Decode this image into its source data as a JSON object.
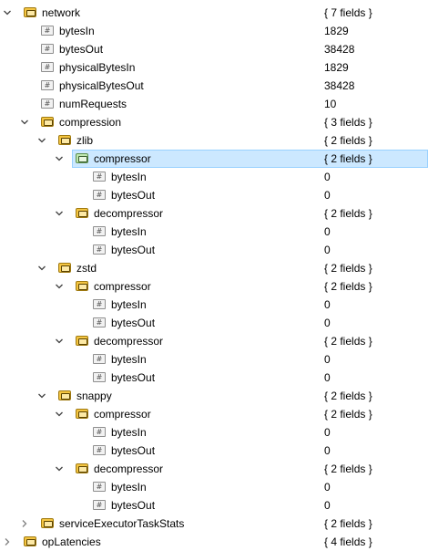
{
  "tree": {
    "rows": [
      {
        "level": 0,
        "kind": "object",
        "toggle": "expanded",
        "label": "network",
        "value": "{ 7 fields }"
      },
      {
        "level": 1,
        "kind": "number",
        "toggle": "none",
        "label": "bytesIn",
        "value": "1829"
      },
      {
        "level": 1,
        "kind": "number",
        "toggle": "none",
        "label": "bytesOut",
        "value": "38428"
      },
      {
        "level": 1,
        "kind": "number",
        "toggle": "none",
        "label": "physicalBytesIn",
        "value": "1829"
      },
      {
        "level": 1,
        "kind": "number",
        "toggle": "none",
        "label": "physicalBytesOut",
        "value": "38428"
      },
      {
        "level": 1,
        "kind": "number",
        "toggle": "none",
        "label": "numRequests",
        "value": "10"
      },
      {
        "level": 1,
        "kind": "object",
        "toggle": "expanded",
        "label": "compression",
        "value": "{ 3 fields }"
      },
      {
        "level": 2,
        "kind": "object",
        "toggle": "expanded",
        "label": "zlib",
        "value": "{ 2 fields }"
      },
      {
        "level": 3,
        "kind": "object",
        "toggle": "expanded",
        "label": "compressor",
        "value": "{ 2 fields }",
        "selected": true
      },
      {
        "level": 4,
        "kind": "number",
        "toggle": "none",
        "label": "bytesIn",
        "value": "0"
      },
      {
        "level": 4,
        "kind": "number",
        "toggle": "none",
        "label": "bytesOut",
        "value": "0"
      },
      {
        "level": 3,
        "kind": "object",
        "toggle": "expanded",
        "label": "decompressor",
        "value": "{ 2 fields }"
      },
      {
        "level": 4,
        "kind": "number",
        "toggle": "none",
        "label": "bytesIn",
        "value": "0"
      },
      {
        "level": 4,
        "kind": "number",
        "toggle": "none",
        "label": "bytesOut",
        "value": "0"
      },
      {
        "level": 2,
        "kind": "object",
        "toggle": "expanded",
        "label": "zstd",
        "value": "{ 2 fields }"
      },
      {
        "level": 3,
        "kind": "object",
        "toggle": "expanded",
        "label": "compressor",
        "value": "{ 2 fields }"
      },
      {
        "level": 4,
        "kind": "number",
        "toggle": "none",
        "label": "bytesIn",
        "value": "0"
      },
      {
        "level": 4,
        "kind": "number",
        "toggle": "none",
        "label": "bytesOut",
        "value": "0"
      },
      {
        "level": 3,
        "kind": "object",
        "toggle": "expanded",
        "label": "decompressor",
        "value": "{ 2 fields }"
      },
      {
        "level": 4,
        "kind": "number",
        "toggle": "none",
        "label": "bytesIn",
        "value": "0"
      },
      {
        "level": 4,
        "kind": "number",
        "toggle": "none",
        "label": "bytesOut",
        "value": "0"
      },
      {
        "level": 2,
        "kind": "object",
        "toggle": "expanded",
        "label": "snappy",
        "value": "{ 2 fields }"
      },
      {
        "level": 3,
        "kind": "object",
        "toggle": "expanded",
        "label": "compressor",
        "value": "{ 2 fields }"
      },
      {
        "level": 4,
        "kind": "number",
        "toggle": "none",
        "label": "bytesIn",
        "value": "0"
      },
      {
        "level": 4,
        "kind": "number",
        "toggle": "none",
        "label": "bytesOut",
        "value": "0"
      },
      {
        "level": 3,
        "kind": "object",
        "toggle": "expanded",
        "label": "decompressor",
        "value": "{ 2 fields }"
      },
      {
        "level": 4,
        "kind": "number",
        "toggle": "none",
        "label": "bytesIn",
        "value": "0"
      },
      {
        "level": 4,
        "kind": "number",
        "toggle": "none",
        "label": "bytesOut",
        "value": "0"
      },
      {
        "level": 1,
        "kind": "object",
        "toggle": "collapsed",
        "label": "serviceExecutorTaskStats",
        "value": "{ 2 fields }"
      },
      {
        "level": 0,
        "kind": "object",
        "toggle": "collapsed",
        "label": "opLatencies",
        "value": "{ 4 fields }"
      }
    ]
  },
  "icons": {
    "object": "object-icon",
    "number": "number-icon",
    "expanded": "chevron-down-icon",
    "collapsed": "chevron-right-icon"
  },
  "colors": {
    "selection_background": "#cce8ff",
    "selection_border": "#99d1ff",
    "object_icon": "#f4c542",
    "selected_object_icon": "#bfe7b0"
  }
}
